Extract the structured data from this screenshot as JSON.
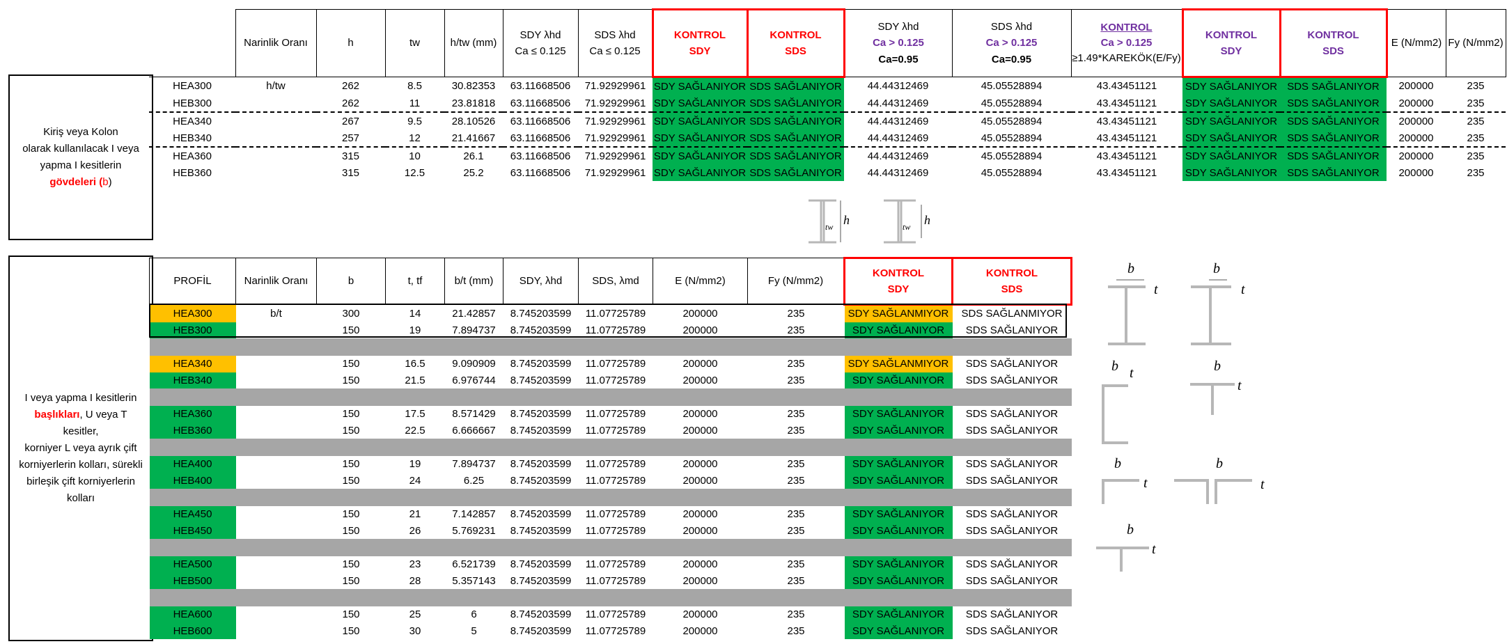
{
  "top": {
    "side_label": {
      "l1": "Kiriş veya Kolon",
      "l2": "olarak kullanılacak I veya",
      "l3": "yapma I kesitlerin",
      "l4_red": "gövdeleri (",
      "l4_b": "b",
      "l4_end": ")"
    },
    "headers": {
      "narlik": "Narinlik Oranı",
      "h": "h",
      "tw": "tw",
      "htw": "h/tw (mm)",
      "sdy1_a": "SDY λhd",
      "sdy1_b": "Ca ≤ 0.125",
      "sds1_a": "SDS λhd",
      "sds1_b": "Ca  ≤ 0.125",
      "k1_a": "KONTROL",
      "k1_b": "SDY",
      "k2_a": "KONTROL",
      "k2_b": "SDS",
      "sdy2_a": "SDY λhd",
      "sdy2_b": "Ca > 0.125",
      "sdy2_c": "Ca=0.95",
      "sds2_a": "SDS λhd",
      "sds2_b": "Ca > 0.125",
      "sds2_c": "Ca=0.95",
      "k3_a": "KONTROL",
      "k3_b": "Ca > 0.125",
      "k3_c": "≥1.49*KAREKÖK(E/Fy)",
      "k4_a": "KONTROL",
      "k4_b": "SDY",
      "k5_a": "KONTROL",
      "k5_b": "SDS",
      "e": "E (N/mm2)",
      "fy": "Fy (N/mm2)"
    },
    "rows": [
      {
        "profil": "HEA300",
        "narlik": "h/tw",
        "h": "262",
        "tw": "8.5",
        "htw": "30.82353",
        "sdy1": "63.11668506",
        "sds1": "71.92929961",
        "k1": "SDY SAĞLANIYOR",
        "k2": "SDS SAĞLANIYOR",
        "sdy2": "44.44312469",
        "sds2": "45.05528894",
        "k3": "43.43451121",
        "k4": "SDY SAĞLANIYOR",
        "k5": "SDS SAĞLANIYOR",
        "e": "200000",
        "fy": "235"
      },
      {
        "profil": "HEB300",
        "narlik": "",
        "h": "262",
        "tw": "11",
        "htw": "23.81818",
        "sdy1": "63.11668506",
        "sds1": "71.92929961",
        "k1": "SDY SAĞLANIYOR",
        "k2": "SDS SAĞLANIYOR",
        "sdy2": "44.44312469",
        "sds2": "45.05528894",
        "k3": "43.43451121",
        "k4": "SDY SAĞLANIYOR",
        "k5": "SDS SAĞLANIYOR",
        "e": "200000",
        "fy": "235"
      },
      {
        "profil": "HEA340",
        "narlik": "",
        "h": "267",
        "tw": "9.5",
        "htw": "28.10526",
        "sdy1": "63.11668506",
        "sds1": "71.92929961",
        "k1": "SDY SAĞLANIYOR",
        "k2": "SDS SAĞLANIYOR",
        "sdy2": "44.44312469",
        "sds2": "45.05528894",
        "k3": "43.43451121",
        "k4": "SDY SAĞLANIYOR",
        "k5": "SDS SAĞLANIYOR",
        "e": "200000",
        "fy": "235"
      },
      {
        "profil": "HEB340",
        "narlik": "",
        "h": "257",
        "tw": "12",
        "htw": "21.41667",
        "sdy1": "63.11668506",
        "sds1": "71.92929961",
        "k1": "SDY SAĞLANIYOR",
        "k2": "SDS SAĞLANIYOR",
        "sdy2": "44.44312469",
        "sds2": "45.05528894",
        "k3": "43.43451121",
        "k4": "SDY SAĞLANIYOR",
        "k5": "SDS SAĞLANIYOR",
        "e": "200000",
        "fy": "235"
      },
      {
        "profil": "HEA360",
        "narlik": "",
        "h": "315",
        "tw": "10",
        "htw": "26.1",
        "sdy1": "63.11668506",
        "sds1": "71.92929961",
        "k1": "SDY SAĞLANIYOR",
        "k2": "SDS SAĞLANIYOR",
        "sdy2": "44.44312469",
        "sds2": "45.05528894",
        "k3": "43.43451121",
        "k4": "SDY SAĞLANIYOR",
        "k5": "SDS SAĞLANIYOR",
        "e": "200000",
        "fy": "235"
      },
      {
        "profil": "HEB360",
        "narlik": "",
        "h": "315",
        "tw": "12.5",
        "htw": "25.2",
        "sdy1": "63.11668506",
        "sds1": "71.92929961",
        "k1": "SDY SAĞLANIYOR",
        "k2": "SDS SAĞLANIYOR",
        "sdy2": "44.44312469",
        "sds2": "45.05528894",
        "k3": "43.43451121",
        "k4": "SDY SAĞLANIYOR",
        "k5": "SDS SAĞLANIYOR",
        "e": "200000",
        "fy": "235"
      }
    ]
  },
  "bottom": {
    "side_label": {
      "l1": "I veya yapma I kesitlerin",
      "l2_red": "başlıkları",
      "l2_end": ", U veya T",
      "l3": "kesitler,",
      "l4": "korniyer L veya ayrık çift",
      "l5": "korniyerlerin kolları, sürekli",
      "l6": "birleşik çift korniyerlerin",
      "l7": "kolları"
    },
    "headers": {
      "profil": "PROFİL",
      "narlik": "Narinlik Oranı",
      "b": "b",
      "ttf": "t, tf",
      "bt": "b/t (mm)",
      "sdy": "SDY, λhd",
      "sds": "SDS, λmd",
      "e": "E (N/mm2)",
      "fy": "Fy (N/mm2)",
      "k1_a": "KONTROL",
      "k1_b": "SDY",
      "k2_a": "KONTROL",
      "k2_b": "SDS"
    },
    "groups": [
      [
        {
          "profil": "HEA300",
          "narlik": "b/t",
          "b": "300",
          "t": "14",
          "bt": "21.42857",
          "sdy": "8.745203599",
          "sds": "11.07725789",
          "e": "200000",
          "fy": "235",
          "k1": "SDY SAĞLANMIYOR",
          "k2": "SDS SAĞLANMIYOR",
          "warn": true
        },
        {
          "profil": "HEB300",
          "narlik": "",
          "b": "150",
          "t": "19",
          "bt": "7.894737",
          "sdy": "8.745203599",
          "sds": "11.07725789",
          "e": "200000",
          "fy": "235",
          "k1": "SDY SAĞLANIYOR",
          "k2": "SDS SAĞLANIYOR",
          "warn": false
        }
      ],
      [
        {
          "profil": "HEA340",
          "narlik": "",
          "b": "150",
          "t": "16.5",
          "bt": "9.090909",
          "sdy": "8.745203599",
          "sds": "11.07725789",
          "e": "200000",
          "fy": "235",
          "k1": "SDY SAĞLANMIYOR",
          "k2": "SDS SAĞLANIYOR",
          "warn": true
        },
        {
          "profil": "HEB340",
          "narlik": "",
          "b": "150",
          "t": "21.5",
          "bt": "6.976744",
          "sdy": "8.745203599",
          "sds": "11.07725789",
          "e": "200000",
          "fy": "235",
          "k1": "SDY SAĞLANIYOR",
          "k2": "SDS SAĞLANIYOR",
          "warn": false
        }
      ],
      [
        {
          "profil": "HEA360",
          "narlik": "",
          "b": "150",
          "t": "17.5",
          "bt": "8.571429",
          "sdy": "8.745203599",
          "sds": "11.07725789",
          "e": "200000",
          "fy": "235",
          "k1": "SDY SAĞLANIYOR",
          "k2": "SDS SAĞLANIYOR",
          "warn": false
        },
        {
          "profil": "HEB360",
          "narlik": "",
          "b": "150",
          "t": "22.5",
          "bt": "6.666667",
          "sdy": "8.745203599",
          "sds": "11.07725789",
          "e": "200000",
          "fy": "235",
          "k1": "SDY SAĞLANIYOR",
          "k2": "SDS SAĞLANIYOR",
          "warn": false
        }
      ],
      [
        {
          "profil": "HEA400",
          "narlik": "",
          "b": "150",
          "t": "19",
          "bt": "7.894737",
          "sdy": "8.745203599",
          "sds": "11.07725789",
          "e": "200000",
          "fy": "235",
          "k1": "SDY SAĞLANIYOR",
          "k2": "SDS SAĞLANIYOR",
          "warn": false
        },
        {
          "profil": "HEB400",
          "narlik": "",
          "b": "150",
          "t": "24",
          "bt": "6.25",
          "sdy": "8.745203599",
          "sds": "11.07725789",
          "e": "200000",
          "fy": "235",
          "k1": "SDY SAĞLANIYOR",
          "k2": "SDS SAĞLANIYOR",
          "warn": false
        }
      ],
      [
        {
          "profil": "HEA450",
          "narlik": "",
          "b": "150",
          "t": "21",
          "bt": "7.142857",
          "sdy": "8.745203599",
          "sds": "11.07725789",
          "e": "200000",
          "fy": "235",
          "k1": "SDY SAĞLANIYOR",
          "k2": "SDS SAĞLANIYOR",
          "warn": false
        },
        {
          "profil": "HEB450",
          "narlik": "",
          "b": "150",
          "t": "26",
          "bt": "5.769231",
          "sdy": "8.745203599",
          "sds": "11.07725789",
          "e": "200000",
          "fy": "235",
          "k1": "SDY SAĞLANIYOR",
          "k2": "SDS SAĞLANIYOR",
          "warn": false
        }
      ],
      [
        {
          "profil": "HEA500",
          "narlik": "",
          "b": "150",
          "t": "23",
          "bt": "6.521739",
          "sdy": "8.745203599",
          "sds": "11.07725789",
          "e": "200000",
          "fy": "235",
          "k1": "SDY SAĞLANIYOR",
          "k2": "SDS SAĞLANIYOR",
          "warn": false
        },
        {
          "profil": "HEB500",
          "narlik": "",
          "b": "150",
          "t": "28",
          "bt": "5.357143",
          "sdy": "8.745203599",
          "sds": "11.07725789",
          "e": "200000",
          "fy": "235",
          "k1": "SDY SAĞLANIYOR",
          "k2": "SDS SAĞLANIYOR",
          "warn": false
        }
      ],
      [
        {
          "profil": "HEA600",
          "narlik": "",
          "b": "150",
          "t": "25",
          "bt": "6",
          "sdy": "8.745203599",
          "sds": "11.07725789",
          "e": "200000",
          "fy": "235",
          "k1": "SDY SAĞLANIYOR",
          "k2": "SDS SAĞLANIYOR",
          "warn": false
        },
        {
          "profil": "HEB600",
          "narlik": "",
          "b": "150",
          "t": "30",
          "bt": "5",
          "sdy": "8.745203599",
          "sds": "11.07725789",
          "e": "200000",
          "fy": "235",
          "k1": "SDY SAĞLANIYOR",
          "k2": "SDS SAĞLANIYOR",
          "warn": false
        }
      ]
    ]
  },
  "diagram_labels": {
    "h": "h",
    "tw": "tw",
    "b": "b",
    "t": "t"
  },
  "colors": {
    "ok": "#00b050",
    "warn": "#ffc000",
    "spacer": "#a6a6a6",
    "kontrol_red": "#ff0000",
    "kontrol_purple": "#7030a0"
  }
}
